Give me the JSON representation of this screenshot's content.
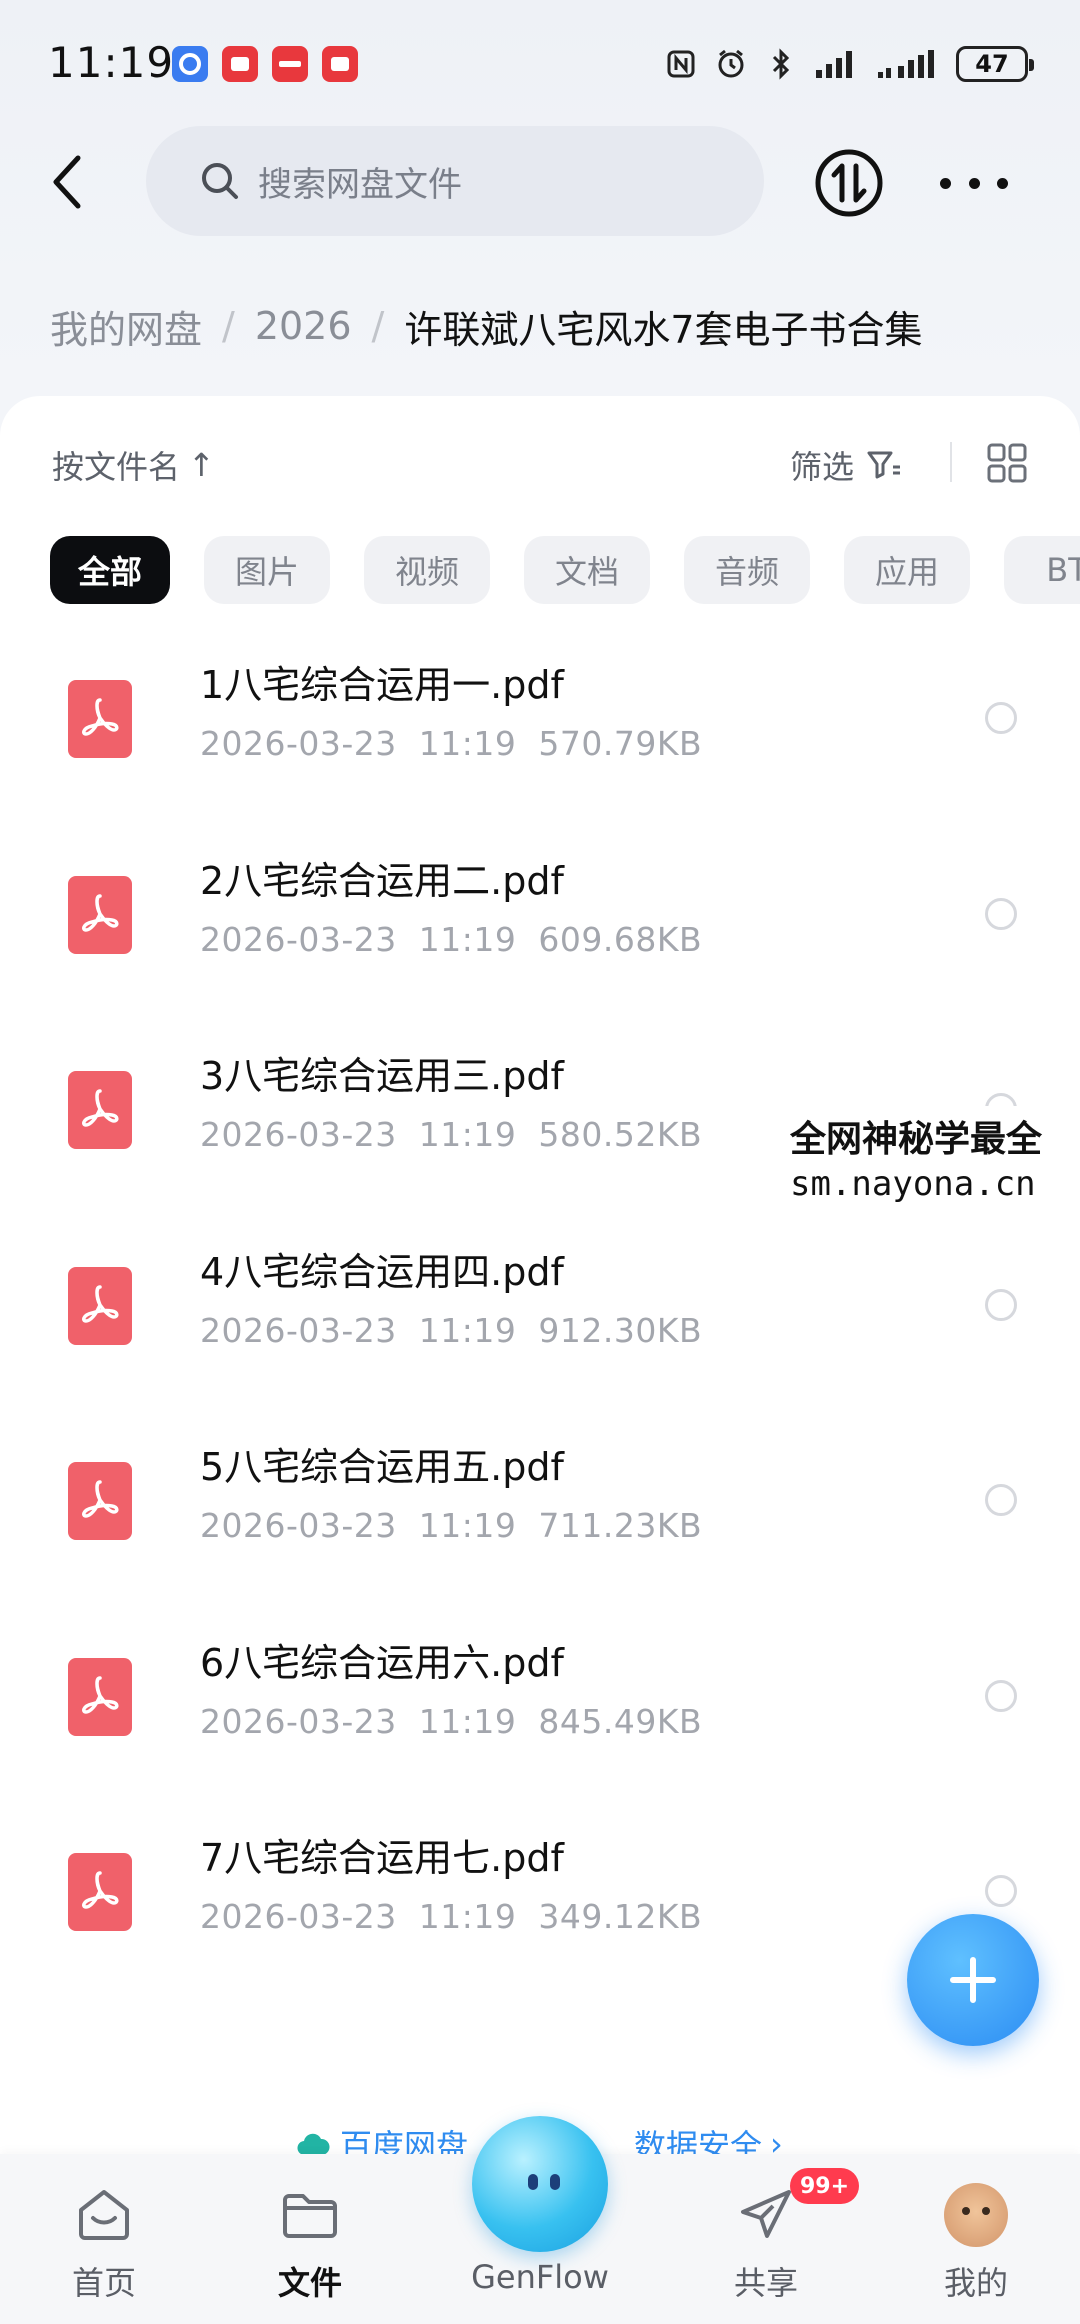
{
  "status_bar": {
    "time": "11:19",
    "battery": "47",
    "app_icons": [
      "qq-icon",
      "red-app-icon",
      "xiaohongshu-icon",
      "red-app-icon"
    ],
    "app_colors": [
      "#3a7cf0",
      "#e8383d",
      "#e8383d",
      "#e8383d"
    ]
  },
  "header": {
    "search_placeholder": "搜索网盘文件"
  },
  "breadcrumb": {
    "items": [
      "我的网盘",
      "2026"
    ],
    "current": "许联斌八宅风水7套电子书合集"
  },
  "toolbar": {
    "sort_label": "按文件名",
    "sort_arrow": "↑",
    "filter_label": "筛选"
  },
  "categories": [
    "全部",
    "图片",
    "视频",
    "文档",
    "音频",
    "应用",
    "BT"
  ],
  "files": [
    {
      "name": "1八宅综合运用一.pdf",
      "date": "2026-03-23",
      "time": "11:19",
      "size": "570.79KB"
    },
    {
      "name": "2八宅综合运用二.pdf",
      "date": "2026-03-23",
      "time": "11:19",
      "size": "609.68KB"
    },
    {
      "name": "3八宅综合运用三.pdf",
      "date": "2026-03-23",
      "time": "11:19",
      "size": "580.52KB"
    },
    {
      "name": "4八宅综合运用四.pdf",
      "date": "2026-03-23",
      "time": "11:19",
      "size": "912.30KB"
    },
    {
      "name": "5八宅综合运用五.pdf",
      "date": "2026-03-23",
      "time": "11:19",
      "size": "711.23KB"
    },
    {
      "name": "6八宅综合运用六.pdf",
      "date": "2026-03-23",
      "time": "11:19",
      "size": "845.49KB"
    },
    {
      "name": "7八宅综合运用七.pdf",
      "date": "2026-03-23",
      "time": "11:19",
      "size": "349.12KB"
    }
  ],
  "watermark": {
    "line1": "全网神秘学最全",
    "line2": "sm.nayona.cn"
  },
  "promo": {
    "text": "百度网盘",
    "text_tail": "数据安全",
    "chevron": "›"
  },
  "bottom_nav": {
    "items": [
      "首页",
      "文件",
      "GenFlow",
      "共享",
      "我的"
    ],
    "active": "文件",
    "badge": "99+"
  },
  "colors": {
    "pdf": "#f0616a",
    "accent": "#2b8cf3",
    "badge": "#ff3b4e"
  }
}
